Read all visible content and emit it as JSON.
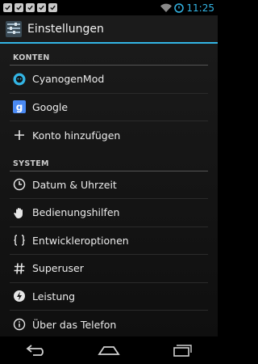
{
  "status_bar": {
    "clock": "11:25",
    "notification_icons": [
      "checkbox-icon",
      "checkbox-icon",
      "checkbox-icon",
      "checkbox-icon",
      "checkbox-icon"
    ],
    "wifi_icon": "wifi-icon",
    "battery_icon": "battery-icon",
    "accent_color": "#33b5e5"
  },
  "action_bar": {
    "title": "Einstellungen",
    "icon": "settings-app-icon"
  },
  "sections": {
    "accounts": {
      "header": "KONTEN",
      "items": [
        {
          "label": "CyanogenMod",
          "icon": "cyanogenmod-icon"
        },
        {
          "label": "Google",
          "icon": "google-icon"
        },
        {
          "label": "Konto hinzufügen",
          "icon": "plus-icon"
        }
      ]
    },
    "system": {
      "header": "SYSTEM",
      "items": [
        {
          "label": "Datum & Uhrzeit",
          "icon": "clock-icon"
        },
        {
          "label": "Bedienungshilfen",
          "icon": "hand-icon"
        },
        {
          "label": "Entwickleroptionen",
          "icon": "braces-icon"
        },
        {
          "label": "Superuser",
          "icon": "hash-icon"
        },
        {
          "label": "Leistung",
          "icon": "performance-icon"
        },
        {
          "label": "Über das Telefon",
          "icon": "info-icon"
        }
      ]
    }
  },
  "nav_bar": {
    "back_icon": "back-icon",
    "home_icon": "home-icon",
    "recents_icon": "recents-icon"
  }
}
